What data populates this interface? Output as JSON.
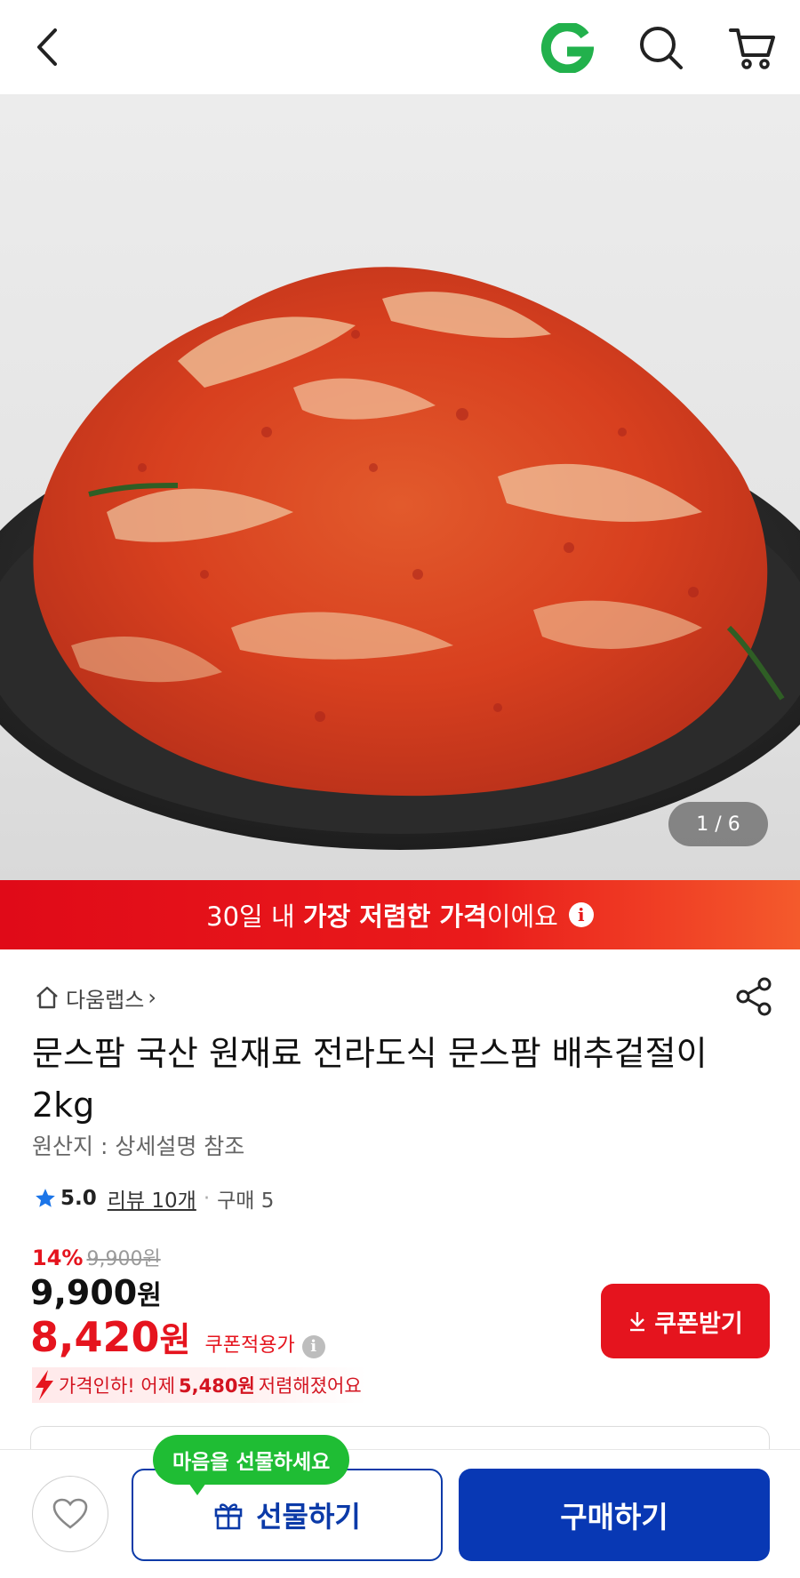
{
  "header": {
    "back_icon": "chevron-left-icon",
    "logo_icon": "gmarket-g-logo",
    "search_icon": "search-icon",
    "cart_icon": "cart-icon",
    "logo_color": "#22b14c"
  },
  "gallery": {
    "counter": "1 / 6"
  },
  "promo_banner": {
    "prefix": "30일 내 ",
    "highlight": "가장 저렴한 가격",
    "suffix": "이에요",
    "info_icon": "i",
    "color": "#e00a18"
  },
  "product": {
    "store_name": "다움랩스",
    "store_chevron": "›",
    "title": "문스팜 국산 원재료 전라도식 문스팜 배추겉절이 2kg",
    "origin": "원산지 : 상세설명 참조",
    "rating": "5.0",
    "reviews": "리뷰 10개",
    "dot": "·",
    "purchases": "구매 5"
  },
  "pricing": {
    "discount_percent": "14%",
    "original_price": "9,900원",
    "price_number": "9,900",
    "price_unit": "원",
    "coupon_price_number": "8,420",
    "coupon_price_unit": "원",
    "coupon_label": "쿠폰적용가",
    "coupon_info_icon": "i",
    "coupon_button": "쿠폰받기",
    "drop_prefix": "가격인하! 어제",
    "drop_amount": "5,480원",
    "drop_suffix": "저렴해졌어요",
    "accent_color": "#e5141e"
  },
  "bottom_bar": {
    "tooltip": "마음을 선물하세요",
    "gift_button": "선물하기",
    "buy_button": "구매하기",
    "wish_icon": "heart-icon",
    "gift_icon": "gift-icon",
    "primary_color": "#0838b4",
    "tooltip_color": "#1fbd34"
  }
}
